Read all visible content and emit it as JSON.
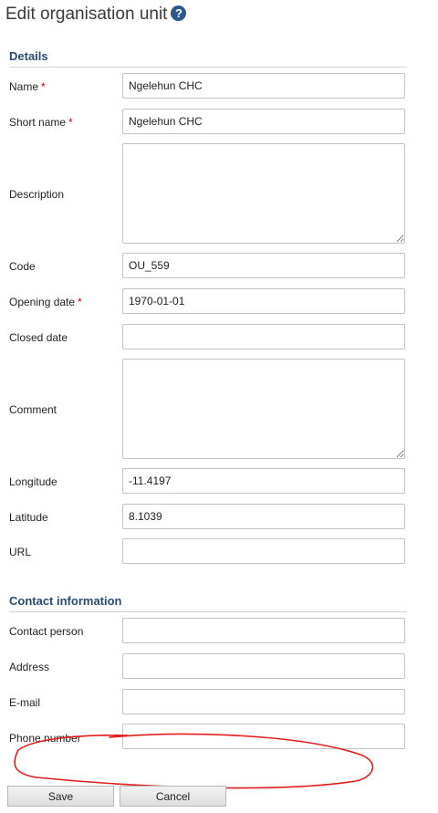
{
  "page": {
    "title": "Edit organisation unit",
    "help_icon_glyph": "?"
  },
  "sections": {
    "details": "Details",
    "contact": "Contact information"
  },
  "required_marker": "*",
  "fields": {
    "name": {
      "label": "Name",
      "value": "Ngelehun CHC",
      "required": true
    },
    "short_name": {
      "label": "Short name",
      "value": "Ngelehun CHC",
      "required": true
    },
    "description": {
      "label": "Description",
      "value": ""
    },
    "code": {
      "label": "Code",
      "value": "OU_559"
    },
    "opening_date": {
      "label": "Opening date",
      "value": "1970-01-01",
      "required": true
    },
    "closed_date": {
      "label": "Closed date",
      "value": ""
    },
    "comment": {
      "label": "Comment",
      "value": ""
    },
    "longitude": {
      "label": "Longitude",
      "value": "-11.4197"
    },
    "latitude": {
      "label": "Latitude",
      "value": "8.1039"
    },
    "url": {
      "label": "URL",
      "value": ""
    },
    "contact_person": {
      "label": "Contact person",
      "value": ""
    },
    "address": {
      "label": "Address",
      "value": ""
    },
    "email": {
      "label": "E-mail",
      "value": ""
    },
    "phone_number": {
      "label": "Phone number",
      "value": ""
    }
  },
  "buttons": {
    "save": "Save",
    "cancel": "Cancel"
  },
  "colors": {
    "section_header": "#2a4a72",
    "required": "#cc0000",
    "annotation": "#e21b1b",
    "help_icon": "#2a5a8c"
  }
}
